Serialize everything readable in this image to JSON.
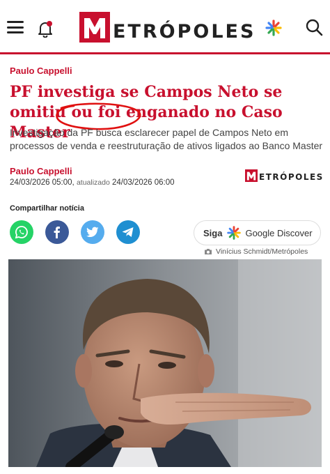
{
  "header": {
    "logo_text": "ETRÓPOLES",
    "logo_letter": "M",
    "icons": [
      "menu-icon",
      "bell-icon",
      "google-star-icon",
      "search-icon"
    ]
  },
  "article": {
    "kicker": "Paulo Cappelli",
    "headline": "PF investiga se Campos Neto se omitiu ou foi enganado no Caso Master",
    "subhead": "Investigação da PF busca esclarecer papel de Campos Neto em processos de venda e reestruturação de ativos ligados ao Banco Master",
    "author": "Paulo Cappelli",
    "published": "24/03/2026 05:00,",
    "updated_label": "atualizado",
    "updated": "24/03/2026 06:00",
    "mini_logo_text": "ETRÓPOLES"
  },
  "share": {
    "label": "Compartilhar notícia",
    "networks": [
      "whatsapp-icon",
      "facebook-icon",
      "twitter-icon",
      "telegram-icon"
    ]
  },
  "discover": {
    "siga": "Siga",
    "label": "Google Discover"
  },
  "photo": {
    "credit": "Vinícius Schmidt/Metrópoles"
  },
  "colors": {
    "brand_red": "#c8102e",
    "whatsapp": "#25d366",
    "facebook": "#3b5998",
    "twitter": "#55acee",
    "telegram": "#1f8fd1"
  }
}
